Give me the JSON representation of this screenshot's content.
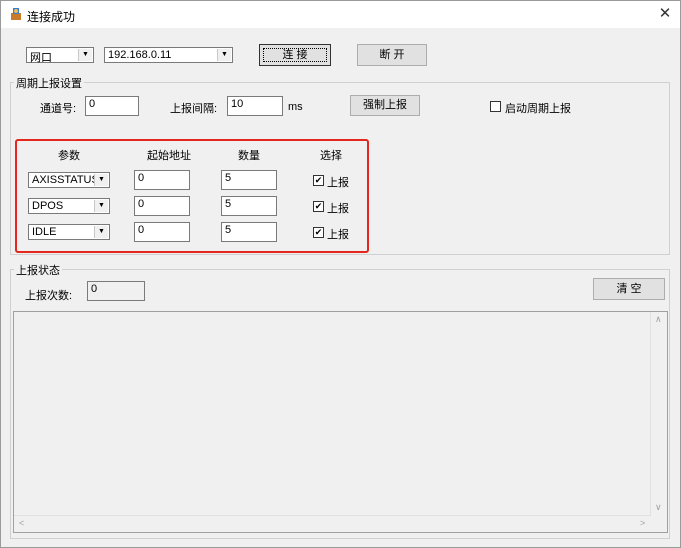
{
  "window": {
    "title": "连接成功",
    "close_glyph": "✕"
  },
  "connection": {
    "type_value": "网口",
    "ip_value": "192.168.0.11",
    "connect_label": "连 接",
    "disconnect_label": "断 开"
  },
  "periodic": {
    "group_title": "周期上报设置",
    "channel_label": "通道号:",
    "channel_value": "0",
    "interval_label": "上报间隔:",
    "interval_value": "10",
    "interval_unit": "ms",
    "force_report_label": "强制上报",
    "enable_periodic_label": "启动周期上报",
    "enable_periodic_checked": false,
    "table": {
      "headers": [
        "参数",
        "起始地址",
        "数量",
        "选择"
      ],
      "rows": [
        {
          "param": "AXISSTATUS",
          "start": "0",
          "count": "5",
          "select_label": "上报",
          "checked": true
        },
        {
          "param": "DPOS",
          "start": "0",
          "count": "5",
          "select_label": "上报",
          "checked": true
        },
        {
          "param": "IDLE",
          "start": "0",
          "count": "5",
          "select_label": "上报",
          "checked": true
        }
      ]
    }
  },
  "status": {
    "group_title": "上报状态",
    "count_label": "上报次数:",
    "count_value": "0",
    "clear_label": "清 空",
    "log_text": ""
  },
  "icons": {
    "dropdown": "▼",
    "check": "✔",
    "scroll_up": "∧",
    "scroll_down": "∨",
    "scroll_left": "<",
    "scroll_right": ">"
  },
  "colors": {
    "highlight": "#e5261f",
    "window_bg": "#f0f0f0"
  }
}
